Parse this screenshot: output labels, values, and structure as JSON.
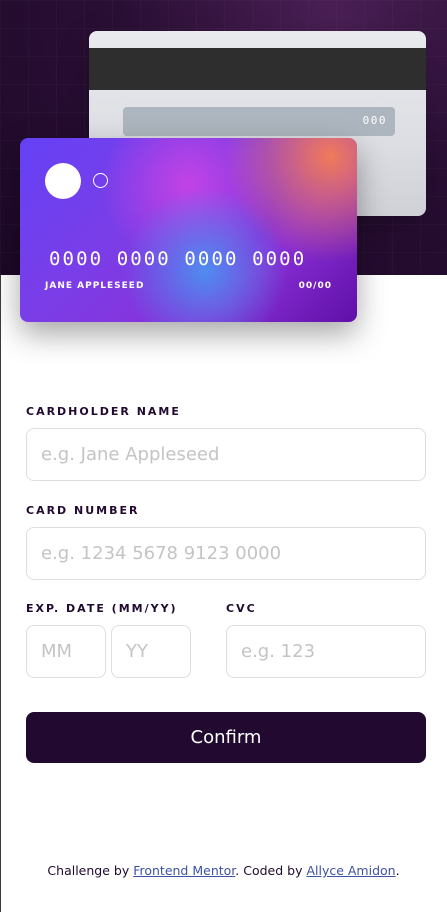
{
  "card_back": {
    "cvc": "000"
  },
  "card_front": {
    "number": "0000 0000 0000 0000",
    "name": "JANE APPLESEED",
    "expiry": "00/00"
  },
  "form": {
    "name_label": "Cardholder Name",
    "name_placeholder": "e.g. Jane Appleseed",
    "number_label": "Card Number",
    "number_placeholder": "e.g. 1234 5678 9123 0000",
    "exp_label": "Exp. Date (MM/YY)",
    "month_placeholder": "MM",
    "year_placeholder": "YY",
    "cvc_label": "CVC",
    "cvc_placeholder": "e.g. 123",
    "confirm_label": "Confirm"
  },
  "footer": {
    "prefix": "Challenge by ",
    "challenge_link": "Frontend Mentor",
    "middle": ". Coded by ",
    "author_link": "Allyce Amidon",
    "suffix": "."
  },
  "colors": {
    "dark_violet": "#21092f",
    "input_border": "#dedddf",
    "placeholder": "#c4c3c6",
    "link": "#3e52a3"
  }
}
